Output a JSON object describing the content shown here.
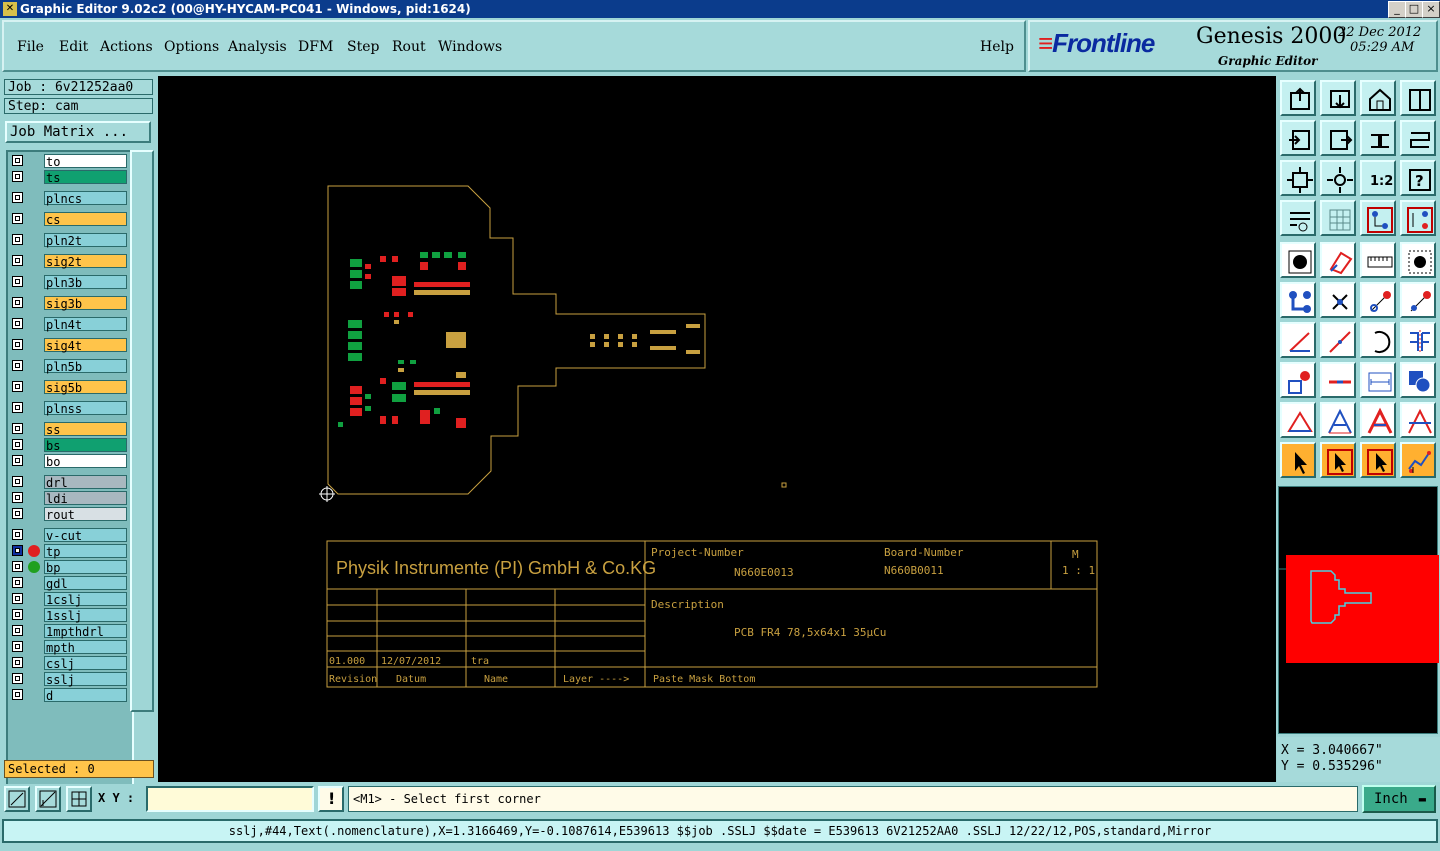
{
  "window": {
    "title": "Graphic Editor 9.02c2 (00@HY-HYCAM-PC041 - Windows, pid:1624)",
    "min_glyph": "_",
    "max_glyph": "□",
    "close_glyph": "×"
  },
  "menu": {
    "items": [
      "File",
      "Edit",
      "Actions",
      "Options",
      "Analysis",
      "DFM",
      "Step",
      "Rout",
      "Windows"
    ],
    "help": "Help"
  },
  "brand": {
    "logo": "Frontline",
    "product": "Genesis 2000",
    "subtitle": "Graphic Editor",
    "date": "22  Dec  2012",
    "time": "05:29  AM"
  },
  "job": {
    "job_label": "Job : 6v21252aa0",
    "step_label": "Step: cam",
    "matrix_button": "Job Matrix ..."
  },
  "layers": [
    {
      "name": "to",
      "color": "#ffffff"
    },
    {
      "name": "ts",
      "color": "#10a070"
    },
    {
      "name": "plncs",
      "color": "#88d0d8"
    },
    {
      "name": "cs",
      "color": "#ffc44a",
      "editable": true
    },
    {
      "name": "pln2t",
      "color": "#88d0d8"
    },
    {
      "name": "sig2t",
      "color": "#ffc44a",
      "editable": true
    },
    {
      "name": "pln3b",
      "color": "#88d0d8"
    },
    {
      "name": "sig3b",
      "color": "#ffc44a",
      "editable": true
    },
    {
      "name": "pln4t",
      "color": "#88d0d8"
    },
    {
      "name": "sig4t",
      "color": "#ffc44a",
      "editable": true
    },
    {
      "name": "pln5b",
      "color": "#88d0d8"
    },
    {
      "name": "sig5b",
      "color": "#ffc44a",
      "editable": true
    },
    {
      "name": "plnss",
      "color": "#88d0d8"
    },
    {
      "name": "ss",
      "color": "#ffc44a",
      "editable": true
    },
    {
      "name": "bs",
      "color": "#10a070"
    },
    {
      "name": "bo",
      "color": "#ffffff"
    },
    {
      "name": "drl",
      "color": "#a8b8c0"
    },
    {
      "name": "ldi",
      "color": "#a8b8c0"
    },
    {
      "name": "rout",
      "color": "#d8e0e4"
    },
    {
      "name": "v-cut",
      "color": "#88d0d8"
    },
    {
      "name": "tp",
      "color": "#88d0d8",
      "dot": "#e02020",
      "selected": true
    },
    {
      "name": "bp",
      "color": "#88d0d8",
      "dot": "#20a020"
    },
    {
      "name": "gdl",
      "color": "#88d0d8"
    },
    {
      "name": "1cslj",
      "color": "#88d0d8"
    },
    {
      "name": "1sslj",
      "color": "#88d0d8"
    },
    {
      "name": "1mpthdrl",
      "color": "#88d0d8"
    },
    {
      "name": "mpth",
      "color": "#88d0d8"
    },
    {
      "name": "cslj",
      "color": "#88d0d8"
    },
    {
      "name": "sslj",
      "color": "#88d0d8"
    },
    {
      "name": "d",
      "color": "#88d0d8"
    }
  ],
  "selected_label": "Selected : 0",
  "title_block": {
    "company": "Physik Instrumente (PI) GmbH & Co.KG",
    "project_label": "Project-Number",
    "project_value": "N660E0013",
    "board_label": "Board-Number",
    "board_value": "N660B0011",
    "scale_top": "M",
    "scale_value": "1 : 1",
    "description_label": "Description",
    "description_value": "PCB FR4 78,5x64x1 35µCu",
    "rev_value": "01.000",
    "date_value": "12/07/2012",
    "name_value": "tra",
    "col_revision": "Revision",
    "col_datum": "Datum",
    "col_name": "Name",
    "col_layer": "Layer ---->",
    "layer_value": "Paste Mask Bottom"
  },
  "coords": {
    "x": "X = 3.040667\"",
    "y": "Y = 0.535296\""
  },
  "command": {
    "xy_label": "X Y :",
    "xy_value": "",
    "prompt": "<M1> - Select first corner",
    "unit": "Inch",
    "unit_glyph": "▬"
  },
  "status": "sslj,#44,Text(.nomenclature),X=1.3166469,Y=-0.1087614,E539613 $$job .SSLJ $$date = E539613 6V21252AA0 .SSLJ 12/22/12,POS,standard,Mirror",
  "colors": {
    "title_bar": "#0b3c8c",
    "panel": "#9fd6d6",
    "canvas": "#000000",
    "outline": "#c8a040",
    "overview_fill": "#ff0000"
  }
}
